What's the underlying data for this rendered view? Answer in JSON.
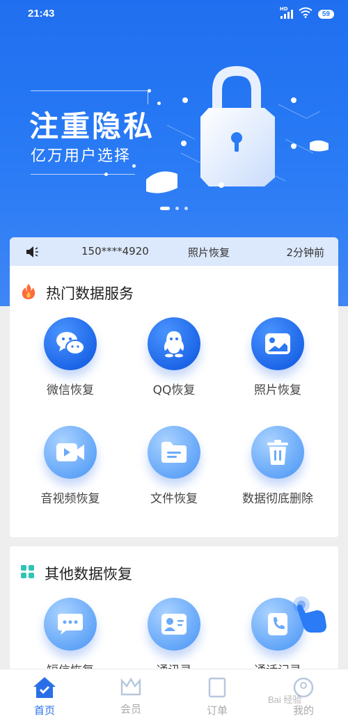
{
  "status_bar": {
    "time": "21:43",
    "battery": "59",
    "network": "HD"
  },
  "banner": {
    "title": "注重隐私",
    "subtitle": "亿万用户选择",
    "page_count": 3,
    "active_page": 1
  },
  "notice": {
    "phone": "150****4920",
    "service": "照片恢复",
    "time_ago": "2分钟前"
  },
  "hot_section": {
    "title": "热门数据服务",
    "items": [
      {
        "label": "微信恢复",
        "icon": "wechat-icon"
      },
      {
        "label": "QQ恢复",
        "icon": "qq-penguin-icon"
      },
      {
        "label": "照片恢复",
        "icon": "photo-icon"
      },
      {
        "label": "音视频恢复",
        "icon": "video-icon"
      },
      {
        "label": "文件恢复",
        "icon": "folder-icon"
      },
      {
        "label": "数据彻底删除",
        "icon": "trash-icon"
      }
    ]
  },
  "other_section": {
    "title": "其他数据恢复",
    "items": [
      {
        "label": "短信恢复",
        "icon": "sms-icon"
      },
      {
        "label": "通讯录",
        "icon": "contacts-icon"
      },
      {
        "label": "通话记录",
        "icon": "call-log-icon"
      }
    ]
  },
  "tabbar": {
    "tabs": [
      {
        "label": "首页",
        "icon": "home-icon",
        "active": true
      },
      {
        "label": "会员",
        "icon": "crown-icon",
        "active": false
      },
      {
        "label": "订单",
        "icon": "order-icon",
        "active": false
      },
      {
        "label": "我的",
        "icon": "profile-icon",
        "active": false
      }
    ]
  },
  "colors": {
    "primary": "#2a7bf5",
    "active_tab": "#2a6fe8",
    "notice_bg": "#dce8fb"
  },
  "watermark": "Bai 经验"
}
